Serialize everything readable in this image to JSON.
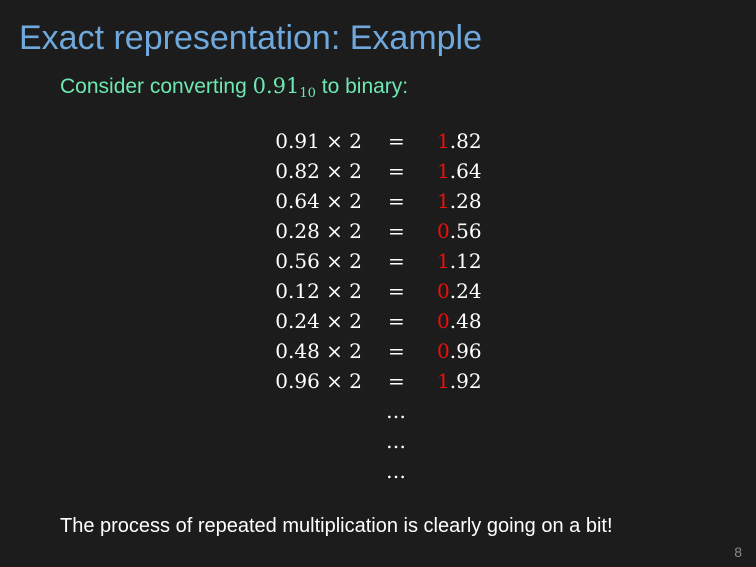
{
  "slide": {
    "title": "Exact representation: Example",
    "intro": {
      "before": "Consider converting ",
      "number": "0.91",
      "base": "10",
      "after": " to binary:"
    },
    "steps": [
      {
        "lhs": "0.91 × 2",
        "eq": "=",
        "bit": "1",
        "frac": ".82"
      },
      {
        "lhs": "0.82 × 2",
        "eq": "=",
        "bit": "1",
        "frac": ".64"
      },
      {
        "lhs": "0.64 × 2",
        "eq": "=",
        "bit": "1",
        "frac": ".28"
      },
      {
        "lhs": "0.28 × 2",
        "eq": "=",
        "bit": "0",
        "frac": ".56"
      },
      {
        "lhs": "0.56 × 2",
        "eq": "=",
        "bit": "1",
        "frac": ".12"
      },
      {
        "lhs": "0.12 × 2",
        "eq": "=",
        "bit": "0",
        "frac": ".24"
      },
      {
        "lhs": "0.24 × 2",
        "eq": "=",
        "bit": "0",
        "frac": ".48"
      },
      {
        "lhs": "0.48 × 2",
        "eq": "=",
        "bit": "0",
        "frac": ".96"
      },
      {
        "lhs": "0.96 × 2",
        "eq": "=",
        "bit": "1",
        "frac": ".92"
      }
    ],
    "continuation": [
      "…",
      "…",
      "…"
    ],
    "conclusion": "The process of repeated multiplication is clearly going on a bit!",
    "page_number": "8"
  },
  "colors": {
    "background": "#1c1c1c",
    "title": "#6fa8dc",
    "intro": "#6ee8b0",
    "body_text": "#ffffff",
    "bit_highlight": "#e8100e",
    "page_number": "#8a8a8a"
  }
}
